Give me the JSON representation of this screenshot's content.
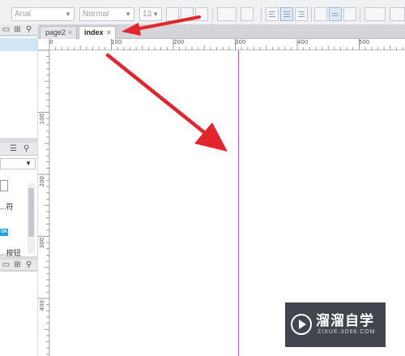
{
  "toolbar": {
    "font_family": "Arial",
    "font_style": "Normal",
    "font_size": "13"
  },
  "library": {
    "items": [
      {
        "label": "...符",
        "icon": "envelope-icon"
      },
      {
        "label": "...按钮",
        "icon": "button-badge-icon",
        "badge": "ON"
      }
    ]
  },
  "tabs": [
    {
      "label": "page2",
      "close": "×"
    },
    {
      "label": "index",
      "close": "×"
    }
  ],
  "ruler": {
    "h_labels": [
      "0",
      "100",
      "200",
      "300",
      "400",
      "500"
    ],
    "v_labels": [
      "100",
      "200",
      "300",
      "400"
    ]
  },
  "colors": {
    "guide": "#e040e8",
    "arrow": "#e3262b",
    "selection": "#cfe6f7"
  },
  "watermark": {
    "title": "溜溜自学",
    "subtitle": "ZIXUE.3D66.COM",
    "icon": "play-logo-icon"
  }
}
